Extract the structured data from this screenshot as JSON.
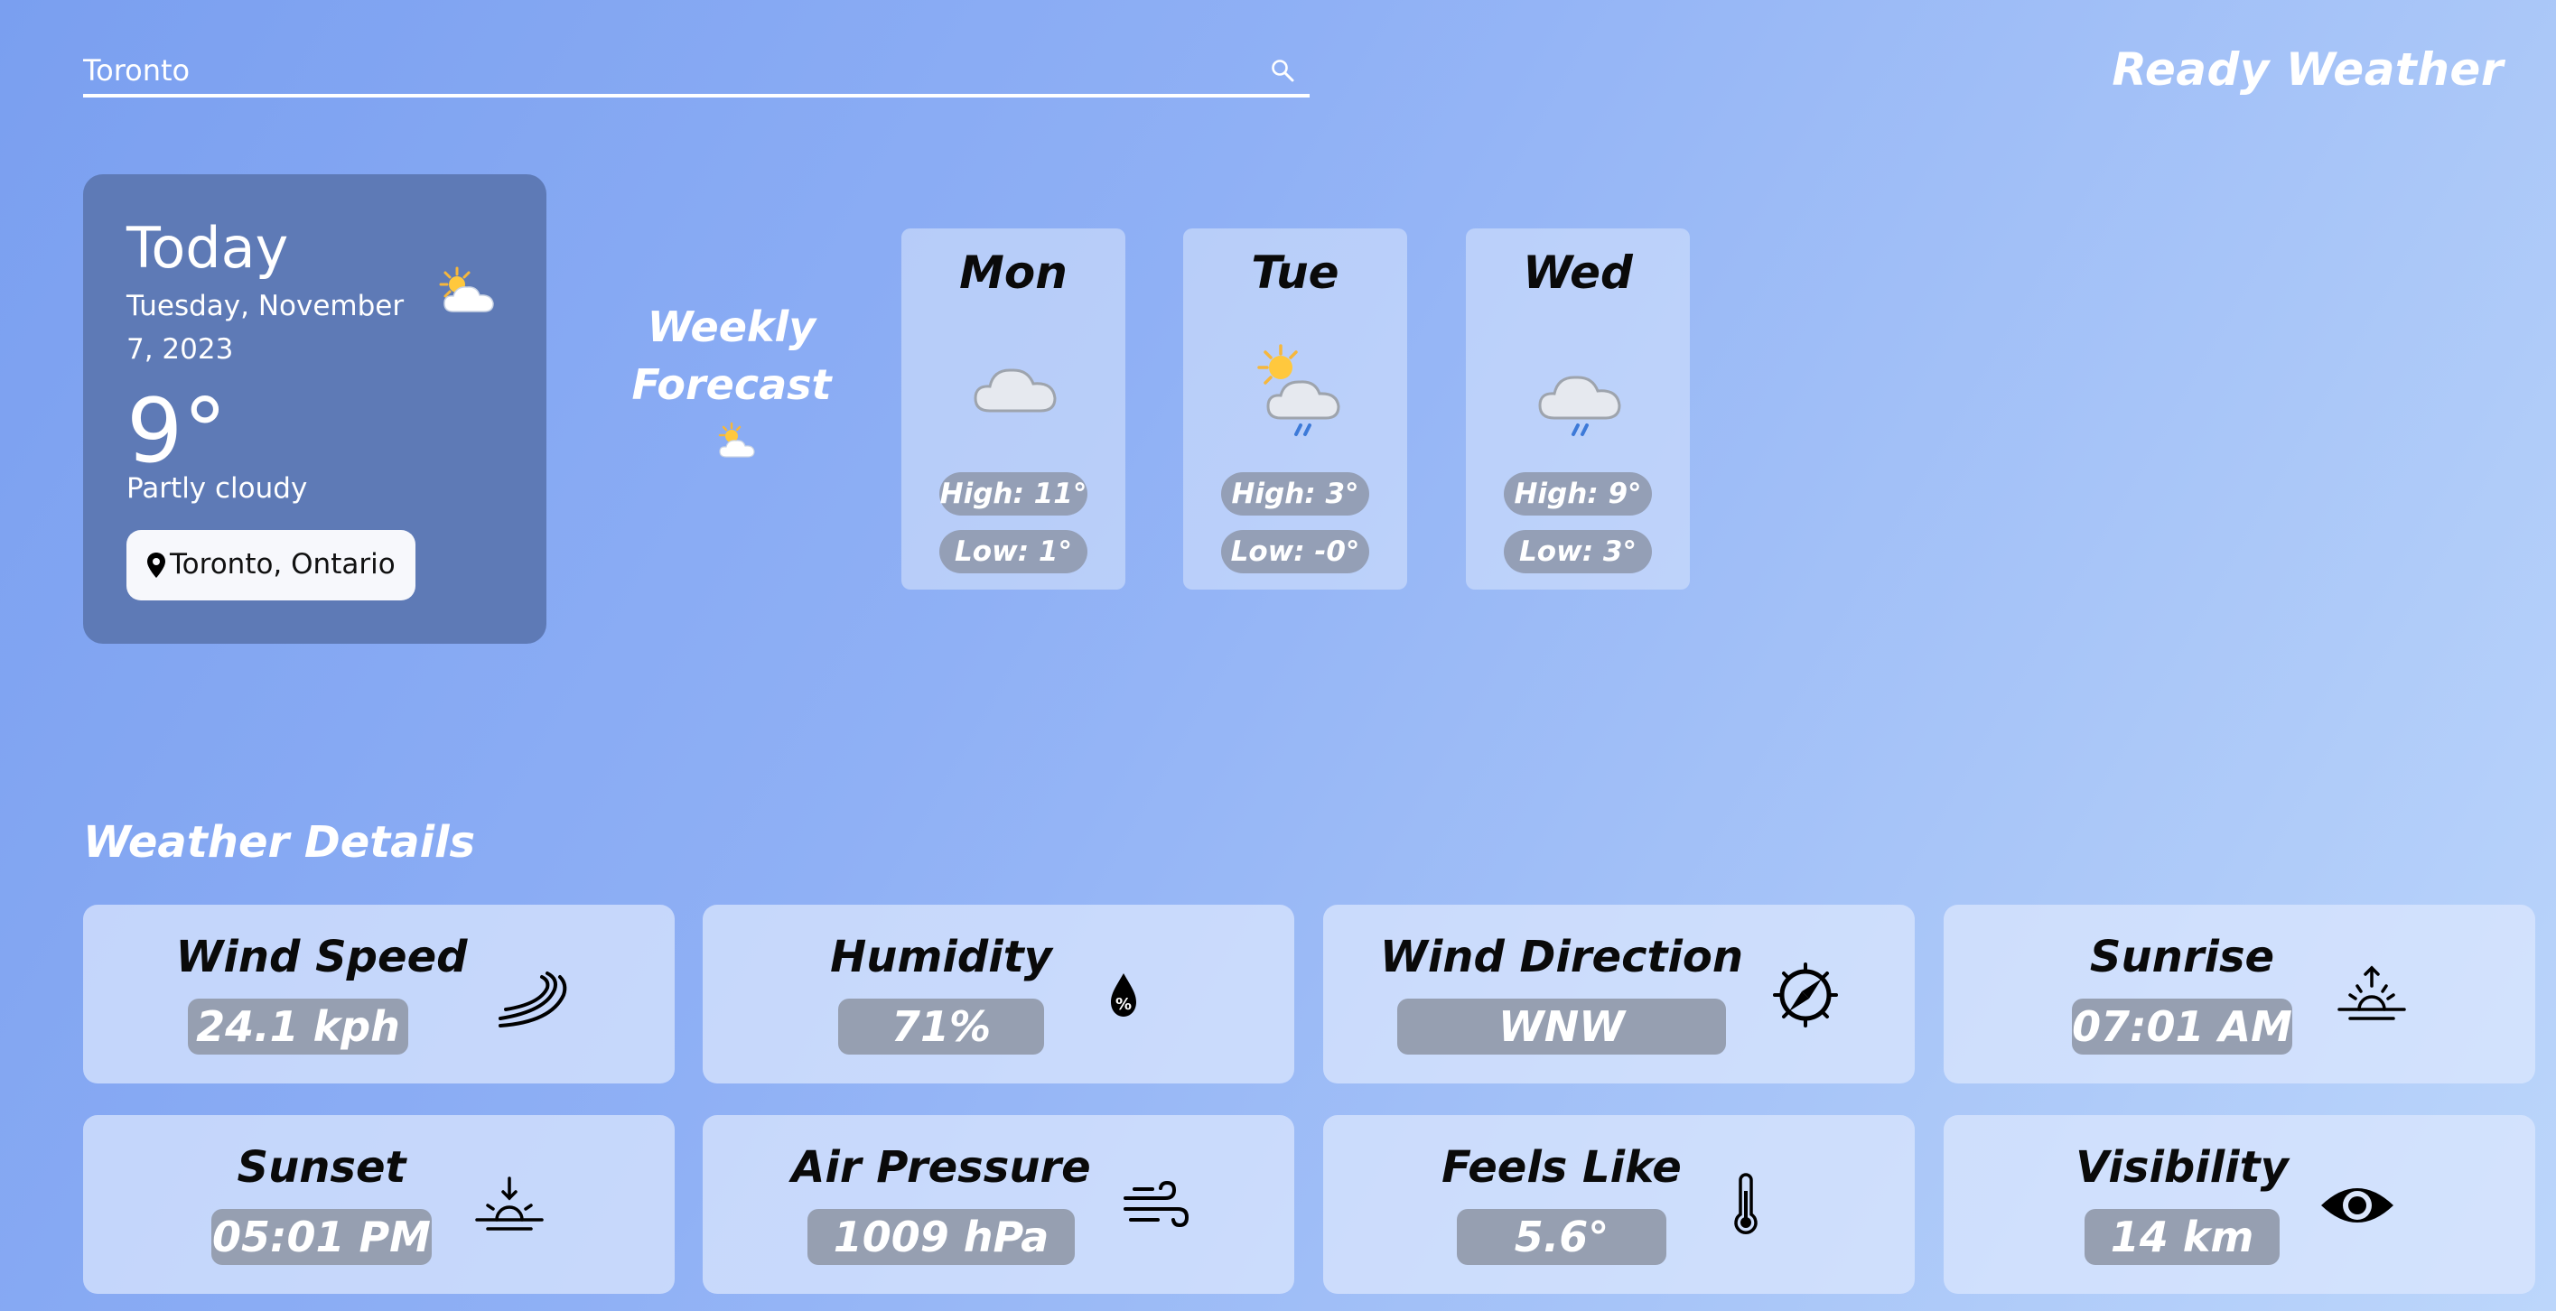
{
  "search": {
    "value": "Toronto",
    "icon": "search-icon"
  },
  "app_title": "Ready Weather",
  "today": {
    "title": "Today",
    "date": "Tuesday, November 7, 2023",
    "temp": "9°",
    "condition": "Partly cloudy",
    "location": "Toronto, Ontario",
    "icon": "partly-cloudy-icon"
  },
  "weekly": {
    "title": "Weekly Forecast",
    "icon": "sun-behind-cloud-icon"
  },
  "forecast": [
    {
      "day": "Mon",
      "high": "High: 11°",
      "low": "Low: 1°",
      "icon": "cloud-icon"
    },
    {
      "day": "Tue",
      "high": "High: 3°",
      "low": "Low: -0°",
      "icon": "sun-cloud-rain-icon"
    },
    {
      "day": "Wed",
      "high": "High: 9°",
      "low": "Low: 3°",
      "icon": "cloud-rain-icon"
    }
  ],
  "details": {
    "title": "Weather Details",
    "items": [
      {
        "label": "Wind Speed",
        "value": "24.1 kph",
        "icon": "wind-speed-icon"
      },
      {
        "label": "Humidity",
        "value": "71%",
        "icon": "humidity-icon"
      },
      {
        "label": "Wind Direction",
        "value": "WNW",
        "icon": "compass-icon"
      },
      {
        "label": "Sunrise",
        "value": "07:01 AM",
        "icon": "sunrise-icon"
      },
      {
        "label": "Sunset",
        "value": "05:01 PM",
        "icon": "sunset-icon"
      },
      {
        "label": "Air Pressure",
        "value": "1009 hPa",
        "icon": "air-pressure-icon"
      },
      {
        "label": "Feels Like",
        "value": "5.6°",
        "icon": "thermometer-icon"
      },
      {
        "label": "Visibility",
        "value": "14 km",
        "icon": "eye-icon"
      }
    ]
  },
  "colors": {
    "background_start": "#7a9ff0",
    "background_end": "#bcd6fb",
    "today_card": "#5e7ab6",
    "pill": "#949fb6"
  }
}
